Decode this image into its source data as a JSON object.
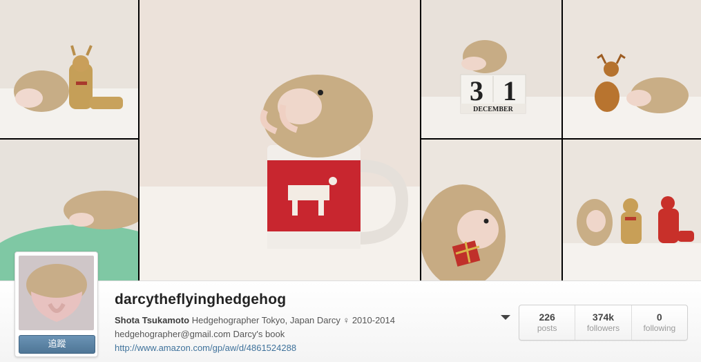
{
  "photos": [
    {
      "subject": "hedgehog-with-wooden-reindeer"
    },
    {
      "subject": "hedgehog-in-christmas-mug"
    },
    {
      "subject": "hedgehog-on-calendar-31-december"
    },
    {
      "subject": "reindeer-figure-and-hedgehog"
    },
    {
      "subject": "hedgehog-on-green-pillow"
    },
    {
      "subject": "hedgehog-holding-gift"
    },
    {
      "subject": "hedgehog-reindeer-santa-figures"
    }
  ],
  "calendar": {
    "day": "31",
    "month": "DECEMBER"
  },
  "profile": {
    "username": "darcytheflyinghedgehog",
    "full_name": "Shota Tsukamoto",
    "bio_line1": "Hedgehographer Tokyo, Japan Darcy ♀ 2010-2014",
    "bio_line2": "hedgehographer@gmail.com Darcy's book",
    "website": "http://www.amazon.com/gp/aw/d/4861524288",
    "follow_label": "追蹤"
  },
  "stats": [
    {
      "value": "226",
      "label": "posts"
    },
    {
      "value": "374k",
      "label": "followers"
    },
    {
      "value": "0",
      "label": "following"
    }
  ],
  "colors": {
    "link": "#3f729b",
    "follow_button": "#517fa4"
  }
}
